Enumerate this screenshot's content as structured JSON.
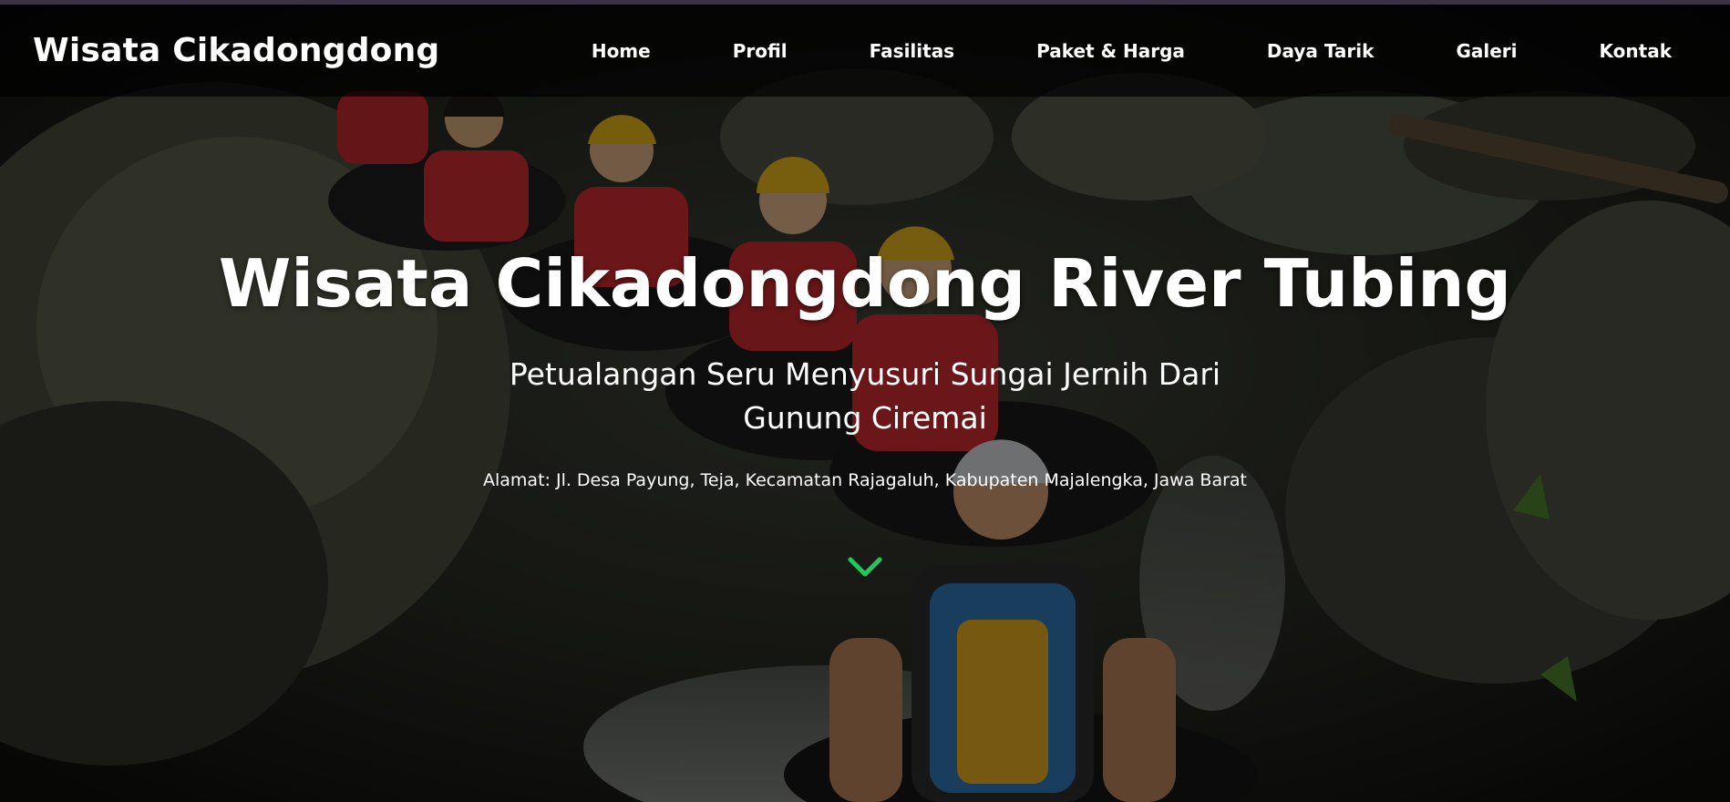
{
  "header": {
    "brand": "Wisata Cikadongdong",
    "nav": [
      {
        "label": "Home"
      },
      {
        "label": "Profil"
      },
      {
        "label": "Fasilitas"
      },
      {
        "label": "Paket & Harga"
      },
      {
        "label": "Daya Tarik"
      },
      {
        "label": "Galeri"
      },
      {
        "label": "Kontak"
      }
    ]
  },
  "hero": {
    "title": "Wisata Cikadongdong River Tubing",
    "subtitle": "Petualangan Seru Menyusuri Sungai Jernih Dari Gunung Ciremai",
    "address": "Alamat: Jl. Desa Payung, Teja, Kecamatan Rajagaluh, Kabupaten Majalengka, Jawa Barat",
    "scroll_icon": "chevron-down-icon"
  },
  "colors": {
    "accent": "#22c55e",
    "navbar_bg": "#000000",
    "text": "#ffffff"
  }
}
